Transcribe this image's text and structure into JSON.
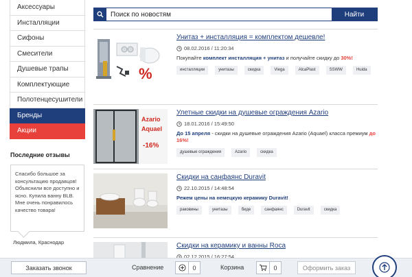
{
  "sidebar": {
    "items": [
      {
        "label": "Аксессуары"
      },
      {
        "label": "Инсталляции"
      },
      {
        "label": "Сифоны"
      },
      {
        "label": "Смесители"
      },
      {
        "label": "Душевые трапы"
      },
      {
        "label": "Комплектующие"
      },
      {
        "label": "Полотенцесушители"
      },
      {
        "label": "Бренды"
      },
      {
        "label": "Акции"
      }
    ],
    "reviews_title": "Последние отзывы",
    "review_text": "Спасибо большое за консультацию продавцов! Объяснили все доступно и ясно. Купила ванну BLB. Мне очень понравилось качество товара!",
    "review_author": "Людмила, Краснодар"
  },
  "search": {
    "placeholder": "Поиск по новостям",
    "button_label": "Найти"
  },
  "news": [
    {
      "title": "Унитаз + инсталляция = комплектом дешевле!",
      "date": "08.02.2016 / 11:20:34",
      "excerpt_pre": "Покупайте ",
      "excerpt_bold": "комплект инсталляция + унитаз",
      "excerpt_mid": " и получайте скидку до ",
      "excerpt_red": "30%!",
      "tags": [
        "инсталляции",
        "унитазы",
        "скидка",
        "Viega",
        "AlcaPlast",
        "SSWW",
        "Huida"
      ],
      "image_text": "%"
    },
    {
      "title": "Улетные скидки на душевые ограждения Azario",
      "date": "18.01.2016 / 15:49:50",
      "excerpt_bold": "До 15 апреля",
      "excerpt_mid": " - скидки на душевые ограждения Azario (Aquael) класса премиум ",
      "excerpt_red": "до 16%!",
      "tags": [
        "душевые ограждения",
        "Azario",
        "скидка"
      ],
      "image_brand1": "Azario",
      "image_brand2": "Aquael",
      "image_discount": "-16%"
    },
    {
      "title": "Скидки на санфаянс Duravit",
      "date": "22.10.2015 / 14:48:54",
      "excerpt_bold": "Режем цены на немецкую керамику Duravit!",
      "tags": [
        "раковины",
        "унитазы",
        "биде",
        "санфаянс",
        "Duravit",
        "скидка"
      ]
    },
    {
      "title": "Скидки на керамику и ванны Roca",
      "date": "02.12.2015 / 16:27:54"
    }
  ],
  "bottom_bar": {
    "callback_label": "Заказать звонок",
    "compare_label": "Сравнение",
    "compare_count": "0",
    "cart_label": "Корзина",
    "cart_count": "0",
    "order_label": "Оформить заказ"
  },
  "colors": {
    "brand": "#1f3e7c",
    "accent_red": "#e8403a"
  }
}
